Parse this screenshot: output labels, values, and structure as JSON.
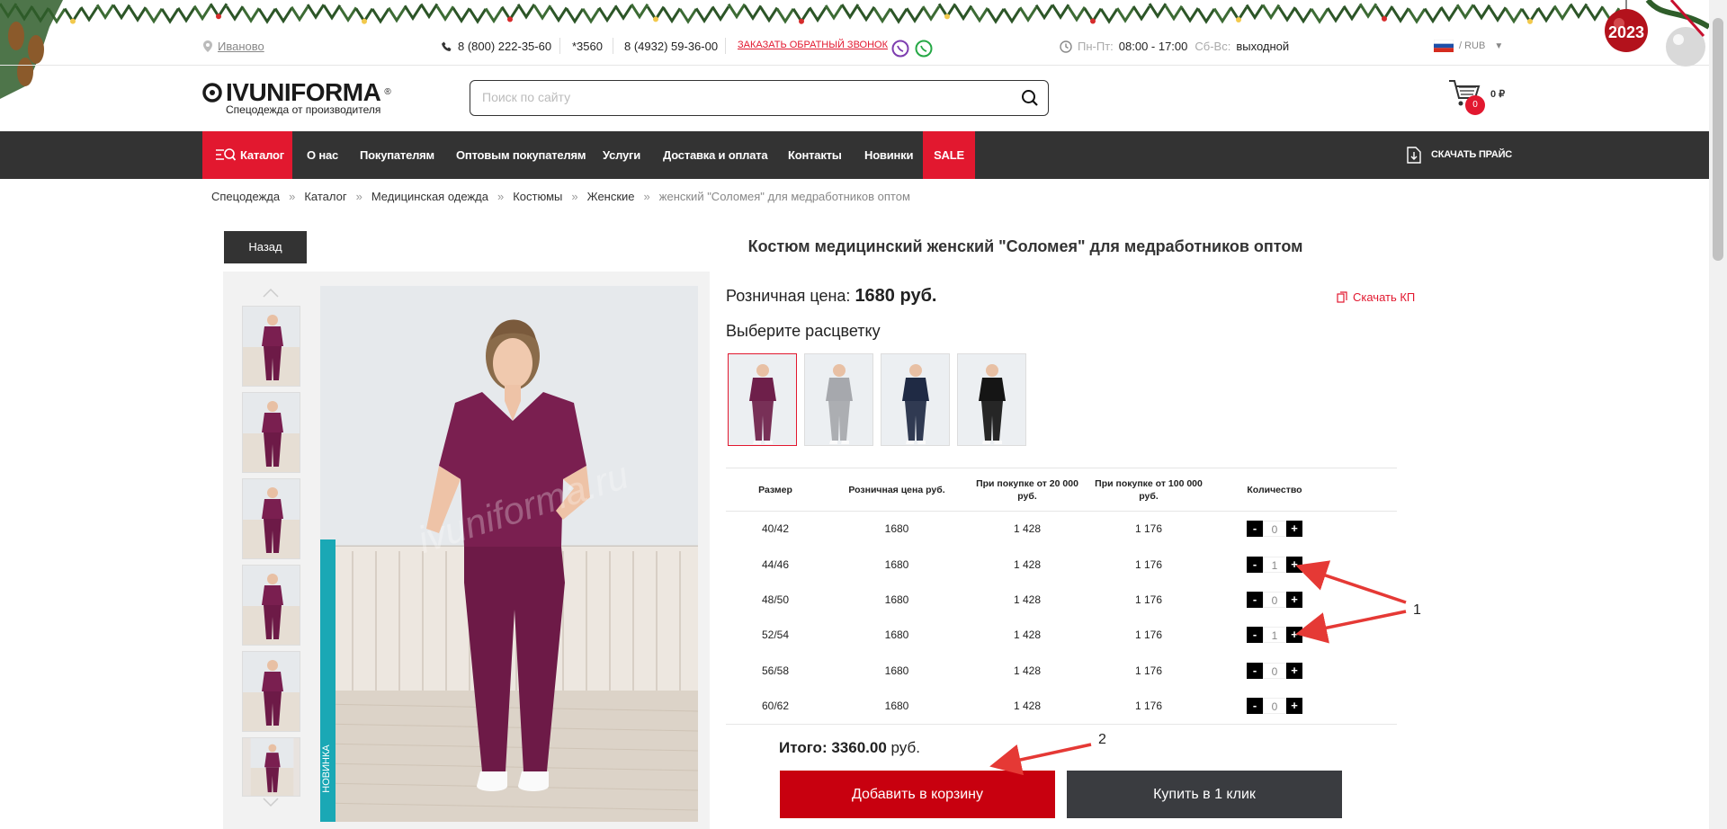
{
  "topbar": {
    "city": "Иваново",
    "phone1": "8 (800) 222-35-60",
    "phone_short": "*3560",
    "phone2": "8 (4932) 59-36-00",
    "callback": "ЗАКАЗАТЬ ОБРАТНЫЙ ЗВОНОК",
    "hours_label1": "Пн-Пт:",
    "hours_value1": "08:00 - 17:00",
    "hours_label2": "Сб-Вс:",
    "hours_value2": "выходной",
    "currency": "/ RUB",
    "new_year_badge": "2023"
  },
  "header": {
    "logo_name": "IVUNIFORMA",
    "logo_reg": "®",
    "logo_tagline": "Спецодежда от производителя",
    "search_placeholder": "Поиск по сайту",
    "cart_count": "0",
    "cart_total": "0 ₽"
  },
  "nav": {
    "catalog": "Каталог",
    "items": [
      "О нас",
      "Покупателям",
      "Оптовым покупателям",
      "Услуги",
      "Доставка и оплата",
      "Контакты",
      "Новинки",
      "SALE"
    ],
    "download": "СКАЧАТЬ ПРАЙС"
  },
  "breadcrumbs": [
    "Спецодежда",
    "Каталог",
    "Медицинская одежда",
    "Костюмы",
    "Женские",
    "женский \"Соломея\" для медработников оптом"
  ],
  "breadcrumb_separator": "»",
  "back_button": "Назад",
  "product": {
    "title": "Костюм медицинский женский \"Соломея\" для медработников оптом",
    "retail_label": "Розничная цена:",
    "retail_price": "1680 руб.",
    "kp_link": "Скачать КП",
    "choose_color": "Выберите расцветку",
    "new_badge": "НОВИНКА",
    "watermark": "ivuniforma.ru",
    "swatches": [
      {
        "color": "#6e1f4a",
        "selected": true
      },
      {
        "color": "#a6a8ad",
        "selected": false
      },
      {
        "color": "#1f2a44",
        "selected": false
      },
      {
        "color": "#151515",
        "selected": false
      }
    ]
  },
  "table": {
    "headers": [
      "Размер",
      "Розничная цена руб.",
      "При покупке от 20 000 руб.",
      "При покупке от 100 000 руб.",
      "Количество"
    ],
    "rows": [
      {
        "size": "40/42",
        "retail": "1680",
        "p20": "1 428",
        "p100": "1 176",
        "qty": "0"
      },
      {
        "size": "44/46",
        "retail": "1680",
        "p20": "1 428",
        "p100": "1 176",
        "qty": "1"
      },
      {
        "size": "48/50",
        "retail": "1680",
        "p20": "1 428",
        "p100": "1 176",
        "qty": "0"
      },
      {
        "size": "52/54",
        "retail": "1680",
        "p20": "1 428",
        "p100": "1 176",
        "qty": "1"
      },
      {
        "size": "56/58",
        "retail": "1680",
        "p20": "1 428",
        "p100": "1 176",
        "qty": "0"
      },
      {
        "size": "60/62",
        "retail": "1680",
        "p20": "1 428",
        "p100": "1 176",
        "qty": "0"
      }
    ],
    "minus": "-",
    "plus": "+"
  },
  "total": {
    "label": "Итого:",
    "value": "3360.00",
    "unit": "руб."
  },
  "buttons": {
    "add_to_cart": "Добавить в корзину",
    "buy_one_click": "Купить в 1 клик"
  },
  "annotations": {
    "label1": "1",
    "label2": "2",
    "arrow_color": "#e53935"
  },
  "colors": {
    "accent": "#e2182f",
    "nav_bg": "#333333",
    "add_btn": "#c8000f",
    "buy_btn": "#3a3c40",
    "new_badge": "#1aa8b5"
  }
}
